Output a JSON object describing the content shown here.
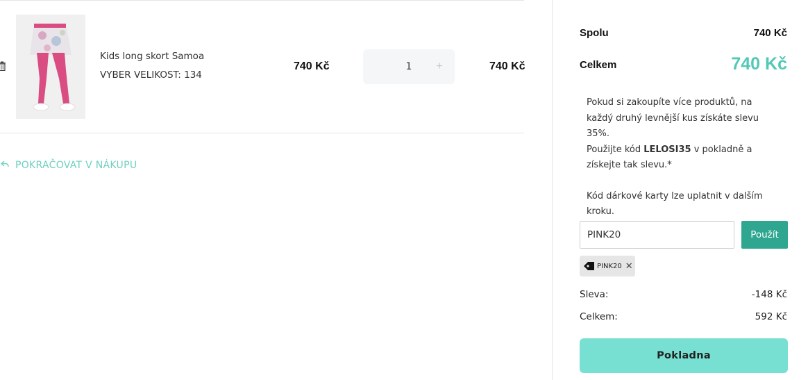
{
  "cart": {
    "item": {
      "name": "Kids long skort Samoa",
      "variant": "VYBER VELIKOST: 134",
      "unit_price": "740 Kč",
      "quantity": "1",
      "plus": "+",
      "line_total": "740 Kč"
    },
    "continue_label": "POKRAČOVAT V NÁKUPU"
  },
  "summary": {
    "subtotal_label": "Spolu",
    "subtotal_value": "740 Kč",
    "total_label": "Celkem",
    "total_value": "740 Kč",
    "promo_line1_text": "Pokud si zakoupíte více produktů, na každý druhý levnější kus získáte slevu 35%.",
    "promo_line2_prefix": "Použijte kód ",
    "promo_code": "LELOSI35",
    "promo_line2_suffix": " v pokladně a získejte tak slevu.*",
    "gift_card_note": "Kód dárkové karty lze uplatnit v dalším kroku.",
    "coupon_value": "PINK20",
    "apply_label": "Použít",
    "applied_coupon": "PINK20",
    "discount_label": "Sleva:",
    "discount_value": "-148 Kč",
    "grand_total_label": "Celkem:",
    "grand_total_value": "592 Kč",
    "checkout_label": "Pokladna"
  },
  "colors": {
    "accent": "#53c9b5",
    "apply_button": "#2fa68f",
    "checkout_button": "#77e0d3"
  },
  "icons": [
    "trash-icon",
    "reply-arrow-icon",
    "tag-icon",
    "close-icon"
  ]
}
